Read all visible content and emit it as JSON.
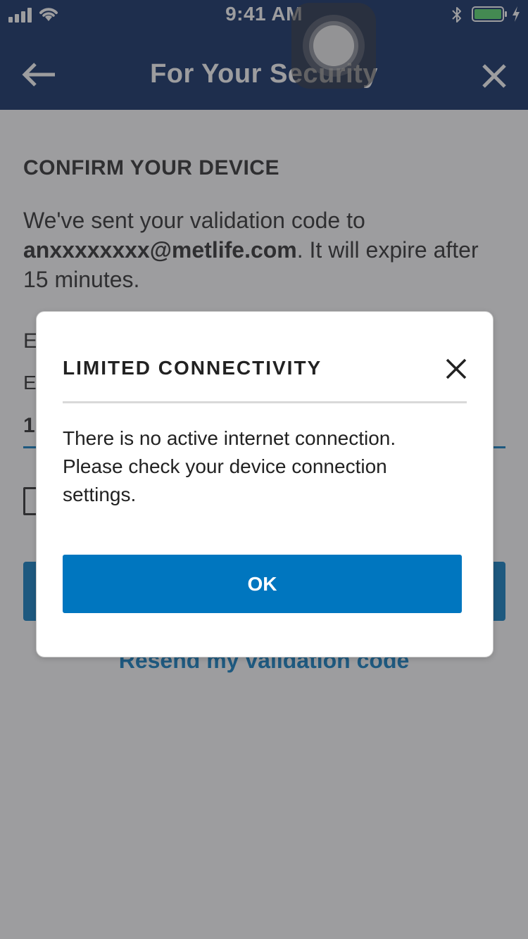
{
  "status_bar": {
    "time": "9:41 AM",
    "icons": [
      "cellular-signal-icon",
      "wifi-icon",
      "bluetooth-icon",
      "battery-icon",
      "charging-bolt-icon"
    ],
    "battery_color": "#4cd964"
  },
  "header": {
    "title": "For Your Security",
    "back_icon": "arrow-left-icon",
    "close_icon": "close-icon",
    "background": "#00205b"
  },
  "main": {
    "section_heading": "CONFIRM YOUR DEVICE",
    "intro_prefix": "We've sent your validation code to ",
    "email": "anxxxxxxxx@metlife.com",
    "intro_suffix": ". It will expire after 15 minutes.",
    "field_label_visible": "E",
    "input_label_visible": "E",
    "code_value_visible": "1",
    "resend_link": "Resend my validation code",
    "accent_color": "#0076bf"
  },
  "dialog": {
    "title": "LIMITED CONNECTIVITY",
    "close_icon": "close-icon",
    "message": "There is no active internet connection. Please check your device connection settings.",
    "ok_label": "OK",
    "button_color": "#0076bf"
  }
}
